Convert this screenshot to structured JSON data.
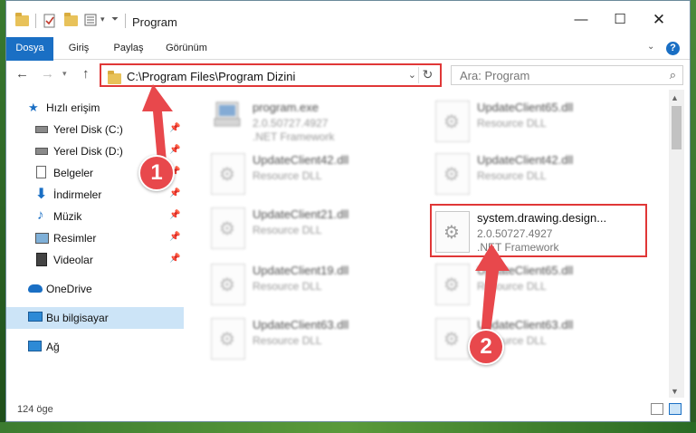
{
  "window": {
    "title": "Program"
  },
  "ribbon": {
    "tabs": [
      "Dosya",
      "Giriş",
      "Paylaş",
      "Görünüm"
    ]
  },
  "nav": {
    "address": "C:\\Program Files\\Program Dizini",
    "search_placeholder": "Ara: Program"
  },
  "sidebar": {
    "items": [
      {
        "label": "Hızlı erişim",
        "icon": "star-icon"
      },
      {
        "label": "Yerel Disk (C:)",
        "icon": "drive-icon"
      },
      {
        "label": "Yerel Disk (D:)",
        "icon": "drive-icon"
      },
      {
        "label": "Belgeler",
        "icon": "documents-icon"
      },
      {
        "label": "İndirmeler",
        "icon": "download-arrow-icon"
      },
      {
        "label": "Müzik",
        "icon": "music-note-icon"
      },
      {
        "label": "Resimler",
        "icon": "pictures-icon"
      },
      {
        "label": "Videolar",
        "icon": "film-icon"
      },
      {
        "label": "OneDrive",
        "icon": "cloud-icon"
      },
      {
        "label": "Bu bilgisayar",
        "icon": "computer-icon"
      },
      {
        "label": "Ağ",
        "icon": "network-icon"
      }
    ]
  },
  "files": [
    {
      "name": "program.exe",
      "line2": "2.0.50727.4927",
      "line3": ".NET Framework",
      "blurred": true
    },
    {
      "name": "UpdateClient65.dll",
      "line2": "Resource DLL",
      "line3": "",
      "blurred": true
    },
    {
      "name": "UpdateClient42.dll",
      "line2": "Resource DLL",
      "line3": "",
      "blurred": true
    },
    {
      "name": "UpdateClient42.dll",
      "line2": "Resource DLL",
      "line3": "",
      "blurred": true
    },
    {
      "name": "UpdateClient21.dll",
      "line2": "Resource DLL",
      "line3": "",
      "blurred": true
    },
    {
      "name": "system.drawing.design...",
      "line2": "2.0.50727.4927",
      "line3": ".NET Framework",
      "blurred": false
    },
    {
      "name": "UpdateClient19.dll",
      "line2": "Resource DLL",
      "line3": "",
      "blurred": true
    },
    {
      "name": "UpdateClient65.dll",
      "line2": "Resource DLL",
      "line3": "",
      "blurred": true
    },
    {
      "name": "UpdateClient63.dll",
      "line2": "Resource DLL",
      "line3": "",
      "blurred": true
    },
    {
      "name": "UpdateClient63.dll",
      "line2": "Resource DLL",
      "line3": "",
      "blurred": true
    }
  ],
  "status": {
    "item_count": "124 öge"
  },
  "annotations": {
    "badge1": "1",
    "badge2": "2",
    "highlight_color": "#e03737",
    "arrow_color": "#e8484c"
  },
  "colors": {
    "accent": "#1a6fc4",
    "selection": "#cce4f7"
  }
}
